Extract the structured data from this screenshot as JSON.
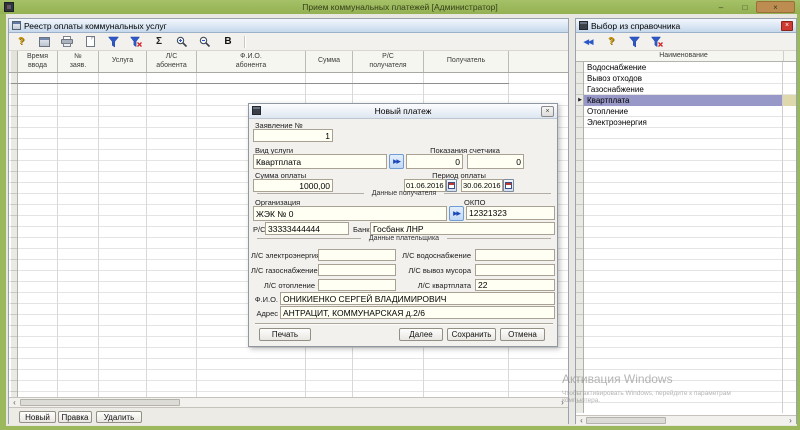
{
  "icons": {
    "help": "?",
    "sum": "Σ",
    "bold": "B",
    "lookup_arrows": "▶▶",
    "back_arrows": "◀◀",
    "scroll_left": "‹",
    "scroll_right": "›",
    "row_marker": "▶",
    "minimize": "–",
    "maximize": "□",
    "close": "×"
  },
  "colors": {
    "titlebar_green": "#9bb95c",
    "close_button_tan": "#bd8c51",
    "selection_purple": "#9898c8",
    "panel_close_red": "#cf3a30",
    "input_ivory": "#fffff4"
  },
  "window": {
    "title": "Прием коммунальных платежей [Администратор]"
  },
  "registry": {
    "title": "Реестр оплаты коммунальных услуг",
    "columns": [
      "Время\nввода",
      "№\nзаяв.",
      "Услуга",
      "Л/С\nабонента",
      "Ф.И.О.\nабонента",
      "Сумма",
      "Р/С\nполучателя",
      "Получатель"
    ],
    "buttons": {
      "new": "Новый",
      "edit": "Правка",
      "delete": "Удалить"
    }
  },
  "reference": {
    "title": "Выбор из справочника",
    "column_header": "Наименование",
    "items": [
      "Водоснабжение",
      "Вывоз отходов",
      "Газоснабжение",
      "Квартплата",
      "Отопление",
      "Электроэнергия"
    ],
    "selected_item": "Квартплата"
  },
  "dialog": {
    "title": "Новый платеж",
    "application_no": {
      "label": "Заявление №",
      "value": "1"
    },
    "service": {
      "label": "Вид услуги",
      "value": "Квартплата"
    },
    "meter": {
      "label": "Показания счетчика",
      "value1": "0",
      "value2": "0"
    },
    "amount": {
      "label": "Сумма оплаты",
      "value": "1000,00"
    },
    "period": {
      "label": "Период оплаты",
      "from": "01.06.2016",
      "to": "30.06.2016"
    },
    "recipient_section": "Данные получателя",
    "organization": {
      "label": "Организация",
      "value": "ЖЭК № 0"
    },
    "okpo": {
      "label": "ОКПО",
      "value": "12321323"
    },
    "account": {
      "label": "Р/С",
      "value": "33333444444"
    },
    "bank": {
      "label": "Банк",
      "value": "Госбанк ЛНР"
    },
    "payer_section": "Данные плательщика",
    "ls_electricity": {
      "label": "Л/С электроэнергия",
      "value": ""
    },
    "ls_water": {
      "label": "Л/С водоснабжение",
      "value": ""
    },
    "ls_gas": {
      "label": "Л/С газоснабжение",
      "value": ""
    },
    "ls_garbage": {
      "label": "Л/С вывоз мусора",
      "value": ""
    },
    "ls_heating": {
      "label": "Л/С отопление",
      "value": ""
    },
    "ls_rent": {
      "label": "Л/С квартплата",
      "value": "22"
    },
    "fio": {
      "label": "Ф.И.О.",
      "value": "ОНИКИЕНКО СЕРГЕЙ ВЛАДИМИРОВИЧ"
    },
    "address": {
      "label": "Адрес",
      "value": "АНТРАЦИТ, КОММУНАРСКАЯ д.2/6"
    },
    "buttons": {
      "print": "Печать",
      "next": "Далее",
      "save": "Сохранить",
      "cancel": "Отмена"
    }
  },
  "watermark": {
    "line1": "Активация Windows",
    "line2": "Чтобы активировать Windows, перейдите к параметрам",
    "line3": "компьютера."
  }
}
